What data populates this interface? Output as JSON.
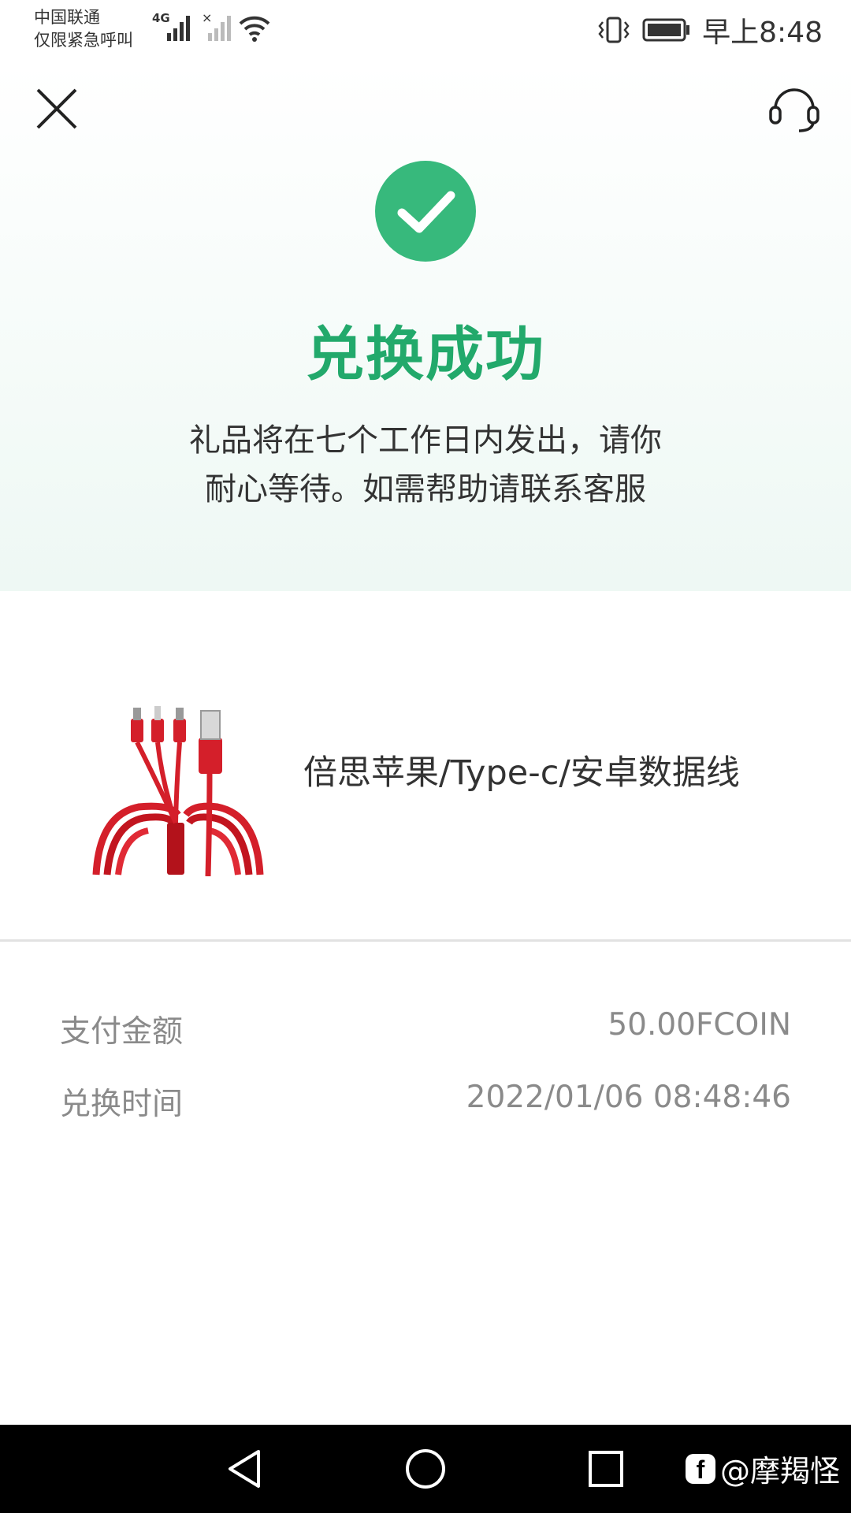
{
  "status_bar": {
    "carrier_line1": "中国联通",
    "carrier_line2": "仅限紧急呼叫",
    "network": "4G",
    "time": "早上8:48"
  },
  "header": {
    "close_icon": "close-icon",
    "support_icon": "headset-icon"
  },
  "result": {
    "icon": "check-circle-icon",
    "title": "兑换成功",
    "message_line1": "礼品将在七个工作日内发出，请你",
    "message_line2": "耐心等待。如需帮助请联系客服"
  },
  "product": {
    "image": "usb-cable-image",
    "name": "倍思苹果/Type-c/安卓数据线"
  },
  "details": {
    "amount_label": "支付金额",
    "amount_value": "50.00FCOIN",
    "time_label": "兑换时间",
    "time_value": "2022/01/06 08:48:46"
  },
  "watermark": {
    "text": "@摩羯怪",
    "logo": "f"
  },
  "colors": {
    "accent": "#22a96b",
    "success_circle": "#37b97c",
    "hero_bg": "#eef8f4",
    "nav_bar": "#000000",
    "product_red": "#d41f2a"
  }
}
